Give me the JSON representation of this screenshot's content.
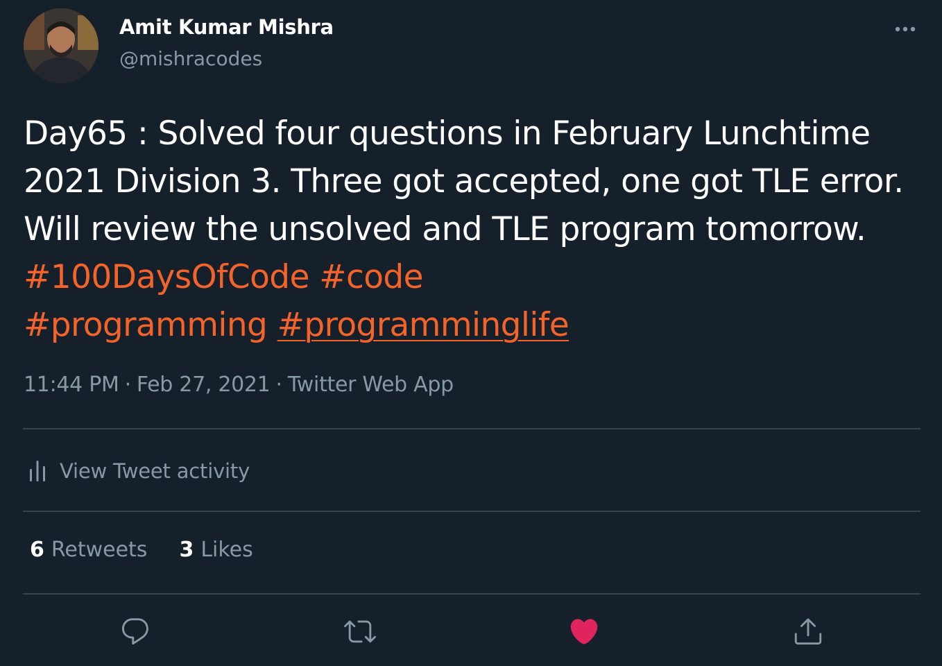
{
  "author": {
    "display_name": "Amit Kumar Mishra",
    "handle": "@mishracodes",
    "avatar_icon": "profile-photo"
  },
  "menu": {
    "more_icon": "more-horizontal-icon"
  },
  "tweet": {
    "lines": [
      "Day65 : Solved four questions in February Lunchtime",
      "2021 Division 3. Three got accepted, one got TLE error.",
      "Will review the unsolved and TLE program tomorrow."
    ],
    "hashtags": [
      "#100DaysOfCode",
      "#code",
      "#programming",
      "#programminglife"
    ]
  },
  "meta": {
    "time": "11:44 PM",
    "separator": "·",
    "date": "Feb 27, 2021",
    "source": "Twitter Web App"
  },
  "activity": {
    "icon": "analytics-bars-icon",
    "label": "View Tweet activity"
  },
  "stats": {
    "retweets_count": "6",
    "retweets_label": "Retweets",
    "likes_count": "3",
    "likes_label": "Likes"
  },
  "actions": {
    "reply_icon": "reply-icon",
    "retweet_icon": "retweet-icon",
    "like_icon": "heart-icon",
    "share_icon": "share-icon"
  },
  "colors": {
    "background": "#15202b",
    "text": "#ffffff",
    "secondary_text": "#8899a6",
    "hashtag": "#f4632a",
    "like": "#e0245e",
    "divider": "#38444d"
  }
}
